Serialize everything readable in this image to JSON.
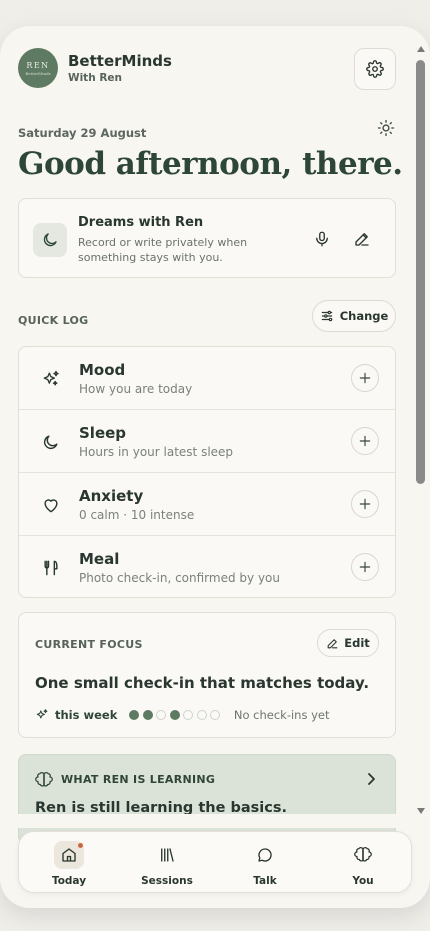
{
  "header": {
    "avatar_text": "REN",
    "avatar_subtext": "BetterMinds",
    "app_name": "BetterMinds",
    "subtitle": "With Ren"
  },
  "date": "Saturday 29 August",
  "greeting": "Good afternoon, there.",
  "dreams": {
    "title": "Dreams with Ren",
    "description": "Record or write privately when something stays with you."
  },
  "quick_log": {
    "label": "QUICK LOG",
    "change_label": "Change",
    "items": [
      {
        "name": "Mood",
        "sub": "How you are today",
        "icon": "sparkles-icon"
      },
      {
        "name": "Sleep",
        "sub": "Hours in your latest sleep",
        "icon": "moon-icon"
      },
      {
        "name": "Anxiety",
        "sub": "0 calm · 10 intense",
        "icon": "heart-icon"
      },
      {
        "name": "Meal",
        "sub": "Photo check-in, confirmed by you",
        "icon": "utensils-icon"
      }
    ]
  },
  "focus": {
    "label": "CURRENT FOCUS",
    "edit_label": "Edit",
    "headline": "One small check-in that matches today.",
    "week_label": "this week",
    "week_dots": [
      true,
      true,
      false,
      true,
      false,
      false,
      false
    ],
    "status": "No check-ins yet"
  },
  "learning": {
    "label": "WHAT REN IS LEARNING",
    "text": "Ren is still learning the basics."
  },
  "nav": {
    "tabs": [
      {
        "label": "Today",
        "active": true,
        "icon": "home-icon"
      },
      {
        "label": "Sessions",
        "active": false,
        "icon": "library-icon"
      },
      {
        "label": "Talk",
        "active": false,
        "icon": "chat-bubble-icon"
      },
      {
        "label": "You",
        "active": false,
        "icon": "brain-icon"
      }
    ]
  },
  "colors": {
    "accent": "#5f7a62",
    "greeting": "#2d4638",
    "learning_bg": "#dbe3d8",
    "badge": "#c9683f"
  }
}
